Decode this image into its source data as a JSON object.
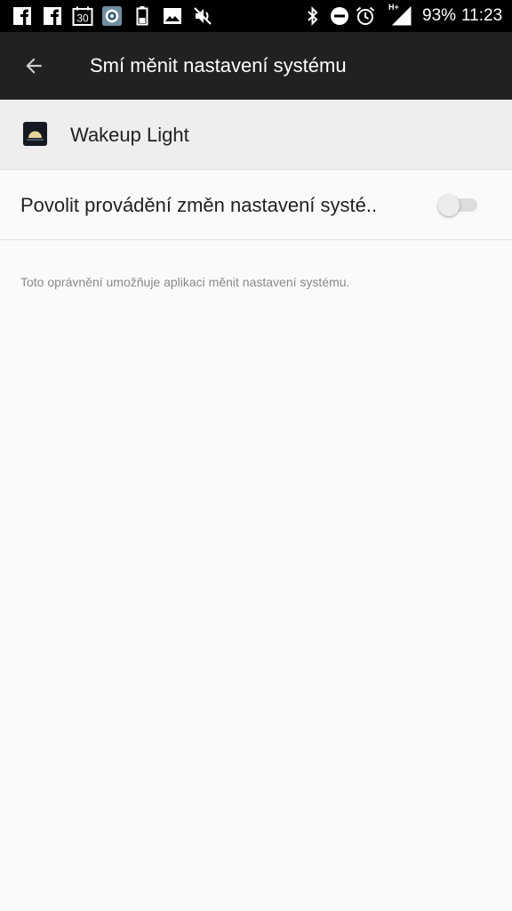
{
  "status_bar": {
    "battery_percent": "93%",
    "time": "11:23",
    "calendar_day": "30",
    "network_type": "H+",
    "icons_left": [
      "facebook-icon",
      "facebook-icon",
      "calendar-icon",
      "app-notification-icon",
      "battery-small-icon",
      "image-icon",
      "volume-off-icon"
    ],
    "icons_right": [
      "bluetooth-icon",
      "do-not-disturb-icon",
      "alarm-icon",
      "signal-icon"
    ]
  },
  "toolbar": {
    "title": "Smí měnit nastavení systému",
    "back_icon": "arrow-back-icon"
  },
  "app": {
    "name": "Wakeup Light",
    "icon": "wakeup-light-app-icon"
  },
  "permission": {
    "label": "Povolit provádění změn nastavení systé..",
    "toggle_state": "off"
  },
  "description": "Toto oprávnění umožňuje aplikaci měnit nastavení systému.",
  "colors": {
    "toolbar_bg": "#212121",
    "statusbar_bg": "#000000",
    "page_bg": "#fafafa",
    "app_row_bg": "#eeeeee"
  }
}
